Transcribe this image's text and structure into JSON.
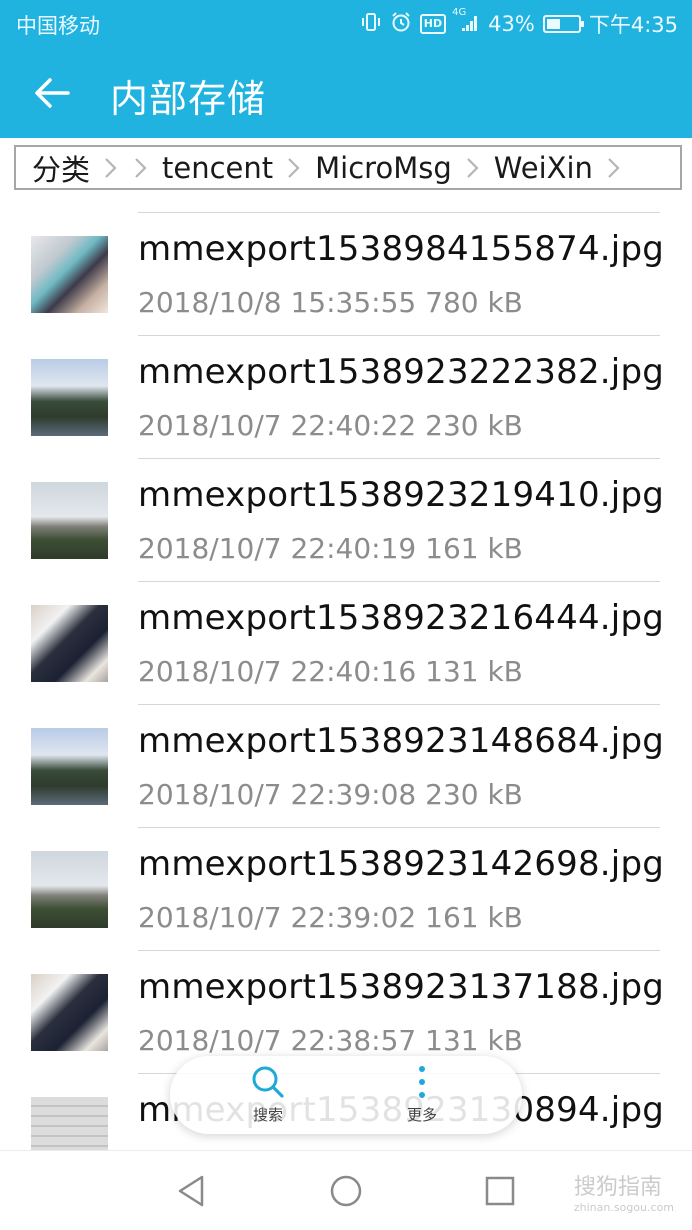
{
  "status_bar": {
    "carrier": "中国移动",
    "network": "4G",
    "hd_label": "HD",
    "battery_percent": "43%",
    "battery_level": 0.43,
    "time": "下午4:35"
  },
  "app_bar": {
    "title": "内部存储"
  },
  "breadcrumb": {
    "items": [
      "分类",
      "",
      "tencent",
      "MicroMsg",
      "WeiXin"
    ]
  },
  "files": [
    {
      "name": "mmexport1538984155874.jpg",
      "meta": "2018/10/8 15:35:55 780 kB",
      "thumb": "cosmetics"
    },
    {
      "name": "mmexport1538923222382.jpg",
      "meta": "2018/10/7 22:40:22 230 kB",
      "thumb": "building"
    },
    {
      "name": "mmexport1538923219410.jpg",
      "meta": "2018/10/7 22:40:19 161 kB",
      "thumb": "street"
    },
    {
      "name": "mmexport1538923216444.jpg",
      "meta": "2018/10/7 22:40:16 131 kB",
      "thumb": "kid"
    },
    {
      "name": "mmexport1538923148684.jpg",
      "meta": "2018/10/7 22:39:08 230 kB",
      "thumb": "building"
    },
    {
      "name": "mmexport1538923142698.jpg",
      "meta": "2018/10/7 22:39:02 161 kB",
      "thumb": "street"
    },
    {
      "name": "mmexport1538923137188.jpg",
      "meta": "2018/10/7 22:38:57 131 kB",
      "thumb": "kid"
    },
    {
      "name": "mmexport1538923130894.jpg",
      "meta": "",
      "thumb": "doc"
    }
  ],
  "floating_actions": {
    "search_label": "搜索",
    "more_label": "更多"
  },
  "watermark": {
    "text": "搜狗指南",
    "domain": "zhinan.sogou.com"
  },
  "colors": {
    "accent": "#20b3e0",
    "secondary_text": "#8c8c8c"
  },
  "icons": [
    "back-arrow-icon",
    "vibrate-icon",
    "alarm-icon",
    "signal-icon",
    "battery-icon",
    "chevron-right-icon",
    "search-icon",
    "more-vertical-icon",
    "nav-back-icon",
    "nav-home-icon",
    "nav-recents-icon"
  ]
}
